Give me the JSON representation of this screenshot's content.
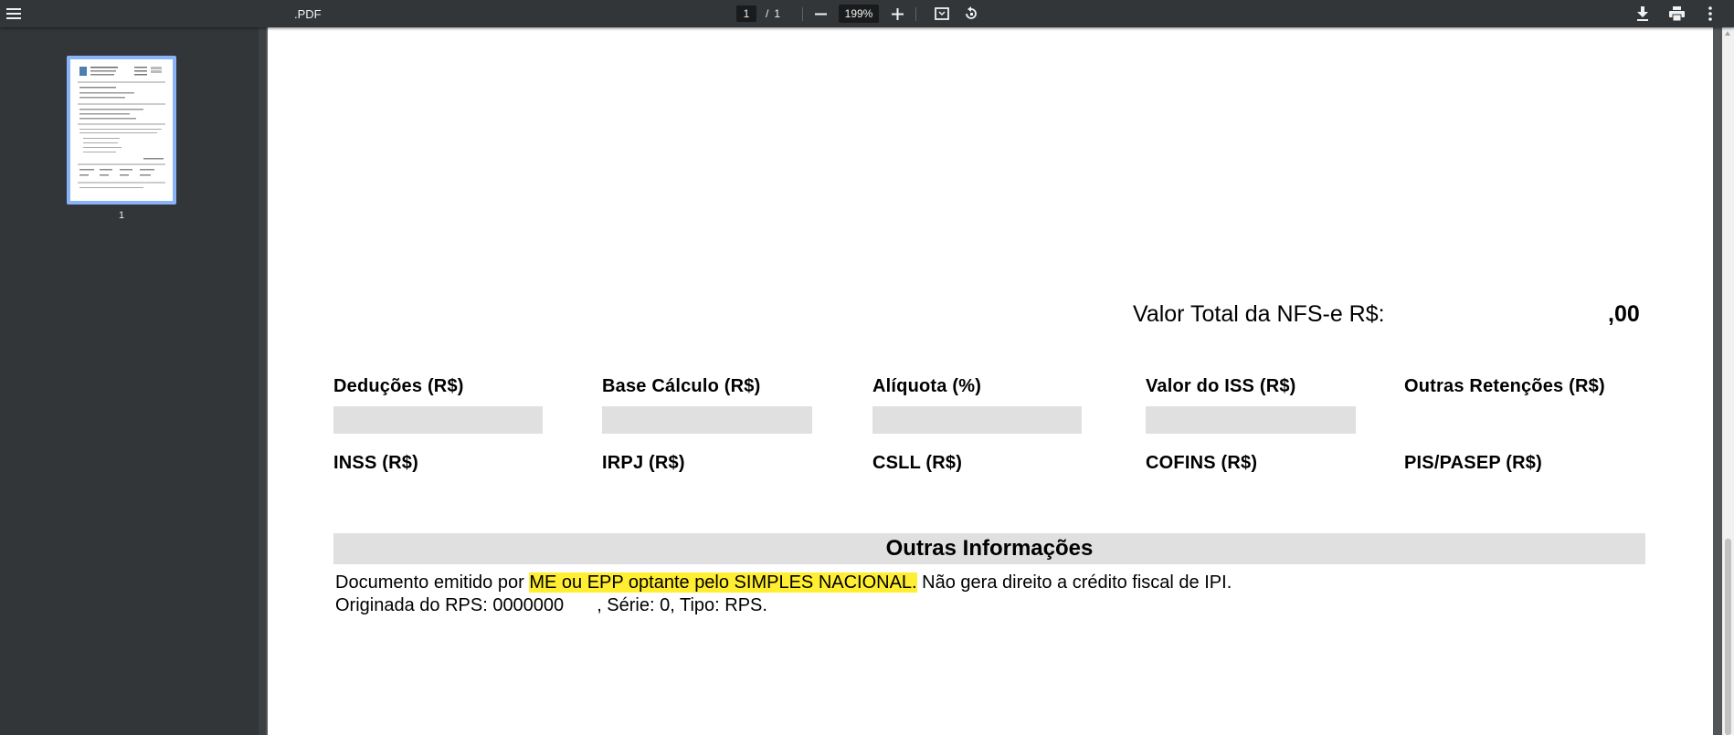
{
  "toolbar": {
    "title": ".PDF",
    "current_page": "1",
    "page_separator": "/",
    "total_pages": "1",
    "zoom": "199%",
    "icons": [
      "menu-icon",
      "zoom-out-icon",
      "zoom-in-icon",
      "fit-page-icon",
      "rotate-icon",
      "download-icon",
      "print-icon",
      "more-options-icon"
    ]
  },
  "sidebar": {
    "thumbnails": [
      {
        "page_label": "1"
      }
    ]
  },
  "document": {
    "total_label": "Valor Total da NFS-e R$:",
    "total_value": ",00",
    "tax_row1": [
      "Deduções (R$)",
      "Base Cálculo (R$)",
      "Alíquota (%)",
      "Valor do ISS (R$)",
      "Outras Retenções (R$)"
    ],
    "tax_row2": [
      "INSS (R$)",
      "IRPJ (R$)",
      "CSLL (R$)",
      "COFINS (R$)",
      "PIS/PASEP (R$)"
    ],
    "other_info": {
      "title": "Outras Informações",
      "line1_before": "Documento emitido por ",
      "line1_highlight": "ME ou EPP optante pelo SIMPLES NACIONAL.",
      "line1_after": " Não gera direito a crédito fiscal de IPI.",
      "line2_part1": "Originada do RPS: 0000000",
      "line2_part2": ", Série: 0, Tipo: RPS."
    }
  },
  "colors": {
    "toolbar_bg": "#323639",
    "viewer_bg": "#525659",
    "thumbnail_selected": "#8ab4f8",
    "field_gray": "#e0e0e0",
    "highlight": "#ffee32"
  }
}
